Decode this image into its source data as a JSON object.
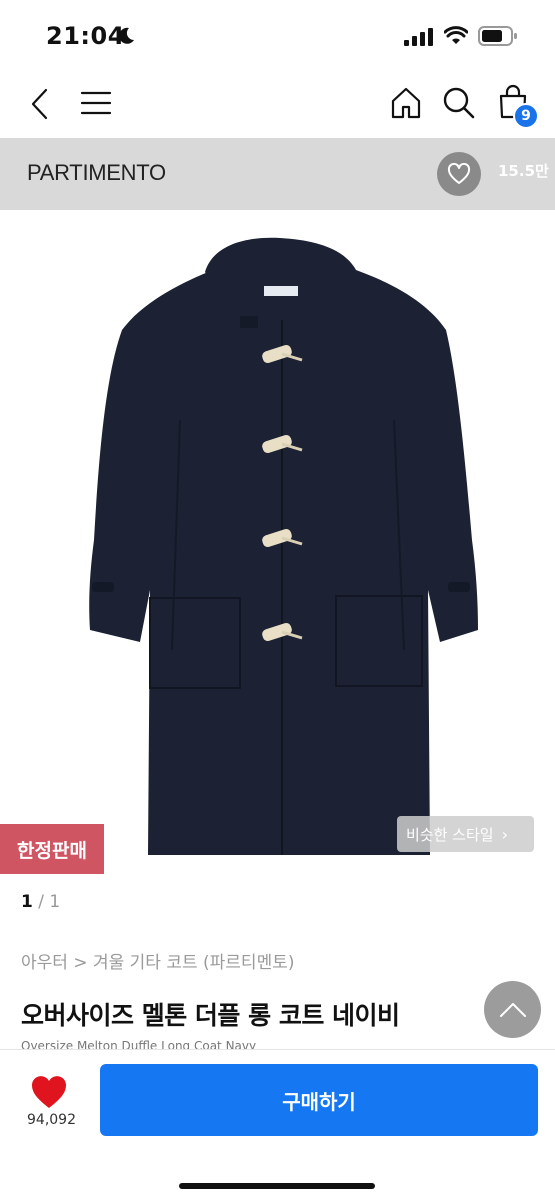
{
  "status": {
    "time": "21:04"
  },
  "nav": {
    "cart_count": "9"
  },
  "brand": {
    "name": "PARTIMENTO",
    "like_count": "15.5만"
  },
  "product": {
    "limited_label": "한정판매",
    "similar_label": "비슷한 스타일",
    "pager_current": "1",
    "pager_total": "/ 1",
    "breadcrumb": "아우터 > 겨울 기타 코트 (파르티멘토)",
    "title": "오버사이즈 멜톤 더플 롱 코트 네이비",
    "subtitle": "Oversize Melton Duffle Long Coat Navy"
  },
  "bottom": {
    "wish_count": "94,092",
    "buy_label": "구매하기"
  },
  "colors": {
    "accent": "#1677f2",
    "badge": "#d05563",
    "heart": "#e0141e",
    "coat": "#1c2233"
  }
}
